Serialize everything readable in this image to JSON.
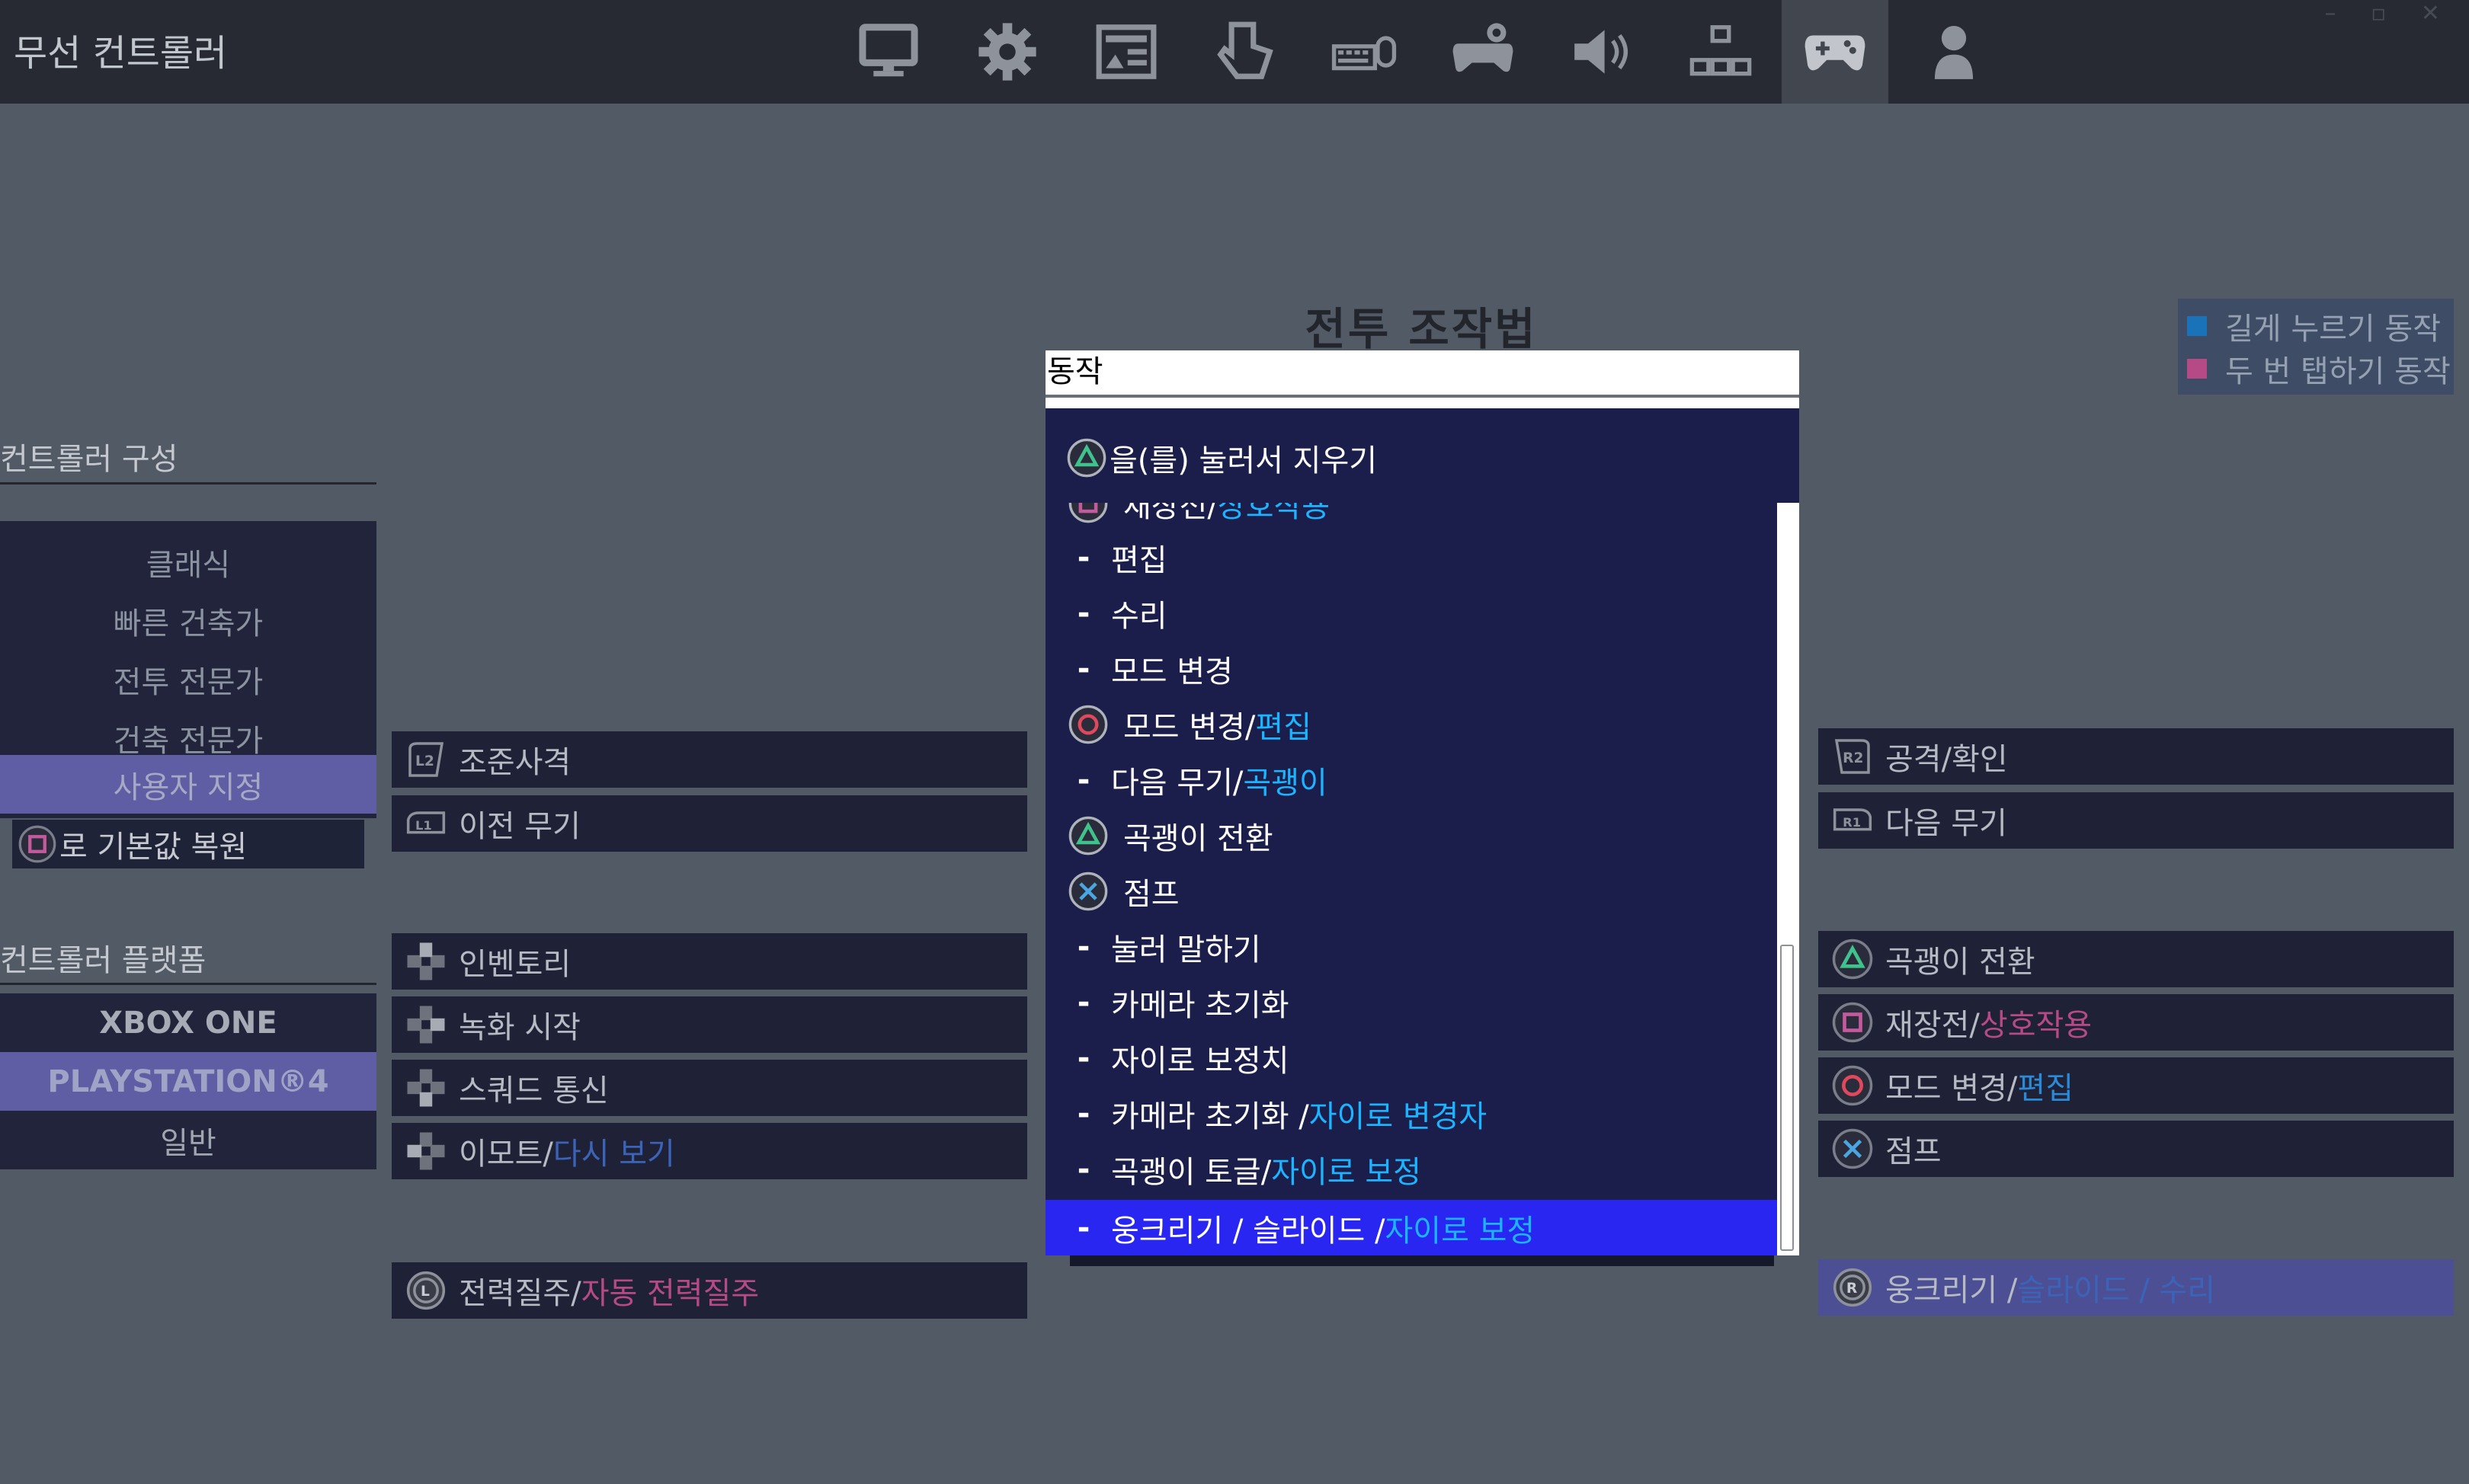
{
  "app": {
    "title": "무선 컨트롤러"
  },
  "nav": {
    "tabs": [
      {
        "name": "display-tab",
        "icon": "monitor-icon"
      },
      {
        "name": "settings-tab",
        "icon": "gear-icon"
      },
      {
        "name": "game-ui-tab",
        "icon": "layout-icon"
      },
      {
        "name": "touch-tab",
        "icon": "touch-hand-icon"
      },
      {
        "name": "keyboard-mouse-tab",
        "icon": "keyboard-mouse-icon"
      },
      {
        "name": "controller-settings-tab",
        "icon": "gamepad-gear-icon"
      },
      {
        "name": "audio-tab",
        "icon": "speaker-icon"
      },
      {
        "name": "accessibility-tab",
        "icon": "network-boxes-icon"
      },
      {
        "name": "wireless-controller-tab",
        "icon": "gamepad-icon",
        "active": true
      },
      {
        "name": "account-tab",
        "icon": "user-icon"
      }
    ],
    "window_controls": "– ▫ ✕"
  },
  "main": {
    "title": "전투 조작법",
    "legend": {
      "hold": {
        "label": "길게 누르기 동작",
        "color": "#1a72b8"
      },
      "double_tap": {
        "label": "두 번 탭하기 동작",
        "color": "#b54a86"
      }
    }
  },
  "sidebar": {
    "config_label": "컨트롤러 구성",
    "presets": [
      "클래식",
      "빠른 건축가",
      "전투 전문가",
      "건축 전문가",
      "사용자 지정"
    ],
    "active_preset": "사용자 지정",
    "restore_label": "로 기본값 복원",
    "platform_label": "컨트롤러 플랫폼",
    "platforms": [
      "XBOX ONE",
      "PLAYSTATION®4",
      "일반"
    ],
    "active_platform": "PLAYSTATION®4"
  },
  "bindings_left": [
    {
      "button": "L2",
      "icon": "l2-icon",
      "action": "조준사격",
      "extra": ""
    },
    {
      "button": "L1",
      "icon": "l1-icon",
      "action": "이전 무기",
      "extra": ""
    },
    {
      "button": "dpad-up",
      "icon": "dpad-up-icon",
      "action": "인벤토리",
      "extra": ""
    },
    {
      "button": "dpad-right",
      "icon": "dpad-right-icon",
      "action": "녹화 시작",
      "extra": ""
    },
    {
      "button": "dpad-down",
      "icon": "dpad-down-icon",
      "action": "스쿼드 통신",
      "extra": ""
    },
    {
      "button": "dpad-left",
      "icon": "dpad-left-icon",
      "action": "이모트/",
      "extra": "다시 보기"
    },
    {
      "button": "L3",
      "icon": "l3-icon",
      "action": "전력질주/",
      "extra": "자동 전력질주"
    }
  ],
  "bindings_right": [
    {
      "button": "R2",
      "icon": "r2-icon",
      "action": "공격/확인",
      "extra": ""
    },
    {
      "button": "R1",
      "icon": "r1-icon",
      "action": "다음 무기",
      "extra": ""
    },
    {
      "button": "triangle",
      "icon": "triangle-icon",
      "action": "곡괭이 전환",
      "extra": ""
    },
    {
      "button": "square",
      "icon": "square-icon",
      "action": "재장전/",
      "extra": "상호작용"
    },
    {
      "button": "circle",
      "icon": "circle-icon",
      "action": "모드 변경/",
      "extra": "편집"
    },
    {
      "button": "cross",
      "icon": "cross-icon",
      "action": "점프",
      "extra": ""
    },
    {
      "button": "R3",
      "icon": "r3-icon",
      "action": "웅크리기 / ",
      "extra": "슬라이드 / 수리"
    }
  ],
  "dropdown": {
    "input_value": "동작",
    "clear_hint": "을(를) 눌러서 지우기",
    "partial_item": {
      "main": "재장전/",
      "extra": "상호작용"
    },
    "items": [
      {
        "type": "dash",
        "main": "편집",
        "extra": ""
      },
      {
        "type": "dash",
        "main": "수리",
        "extra": ""
      },
      {
        "type": "dash",
        "main": "모드 변경",
        "extra": ""
      },
      {
        "type": "circle",
        "main": "모드 변경/",
        "extra": "편집"
      },
      {
        "type": "dash",
        "main": "다음 무기/",
        "extra": "곡괭이"
      },
      {
        "type": "triangle",
        "main": "곡괭이 전환",
        "extra": ""
      },
      {
        "type": "cross",
        "main": "점프",
        "extra": ""
      },
      {
        "type": "dash",
        "main": "눌러 말하기",
        "extra": ""
      },
      {
        "type": "dash",
        "main": "카메라 초기화",
        "extra": ""
      },
      {
        "type": "dash",
        "main": "자이로 보정치",
        "extra": ""
      },
      {
        "type": "dash",
        "main": "카메라 초기화 / ",
        "extra": "자이로 변경자"
      },
      {
        "type": "dash",
        "main": "곡괭이 토글/",
        "extra": "자이로 보정"
      },
      {
        "type": "dash",
        "main": "웅크리기 / 슬라이드 / ",
        "extra": "자이로 보정",
        "selected": true
      }
    ],
    "dash_glyph": "-"
  }
}
